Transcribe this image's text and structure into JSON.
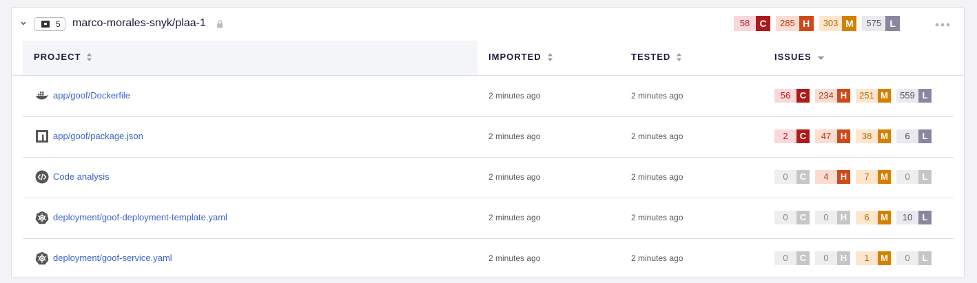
{
  "org": {
    "count": "5",
    "name": "marco-morales-snyk/plaa-1",
    "totals": [
      {
        "value": "58",
        "letter": "C",
        "level": "critical"
      },
      {
        "value": "285",
        "letter": "H",
        "level": "high"
      },
      {
        "value": "303",
        "letter": "M",
        "level": "medium"
      },
      {
        "value": "575",
        "letter": "L",
        "level": "low"
      }
    ]
  },
  "columns": {
    "project": "PROJECT",
    "imported": "IMPORTED",
    "tested": "TESTED",
    "issues": "ISSUES"
  },
  "rows": [
    {
      "icon": "docker-icon",
      "name": "app/goof/Dockerfile",
      "imported": "2 minutes ago",
      "tested": "2 minutes ago",
      "issues": {
        "c": "56",
        "h": "234",
        "m": "251",
        "l": "559"
      }
    },
    {
      "icon": "npm-icon",
      "name": "app/goof/package.json",
      "imported": "2 minutes ago",
      "tested": "2 minutes ago",
      "issues": {
        "c": "2",
        "h": "47",
        "m": "38",
        "l": "6"
      }
    },
    {
      "icon": "code-analysis-icon",
      "name": "Code analysis",
      "imported": "2 minutes ago",
      "tested": "2 minutes ago",
      "issues": {
        "c": "0",
        "h": "4",
        "m": "7",
        "l": "0"
      }
    },
    {
      "icon": "kubernetes-icon",
      "name": "deployment/goof-deployment-template.yaml",
      "imported": "2 minutes ago",
      "tested": "2 minutes ago",
      "issues": {
        "c": "0",
        "h": "0",
        "m": "6",
        "l": "10"
      }
    },
    {
      "icon": "kubernetes-icon",
      "name": "deployment/goof-service.yaml",
      "imported": "2 minutes ago",
      "tested": "2 minutes ago",
      "issues": {
        "c": "0",
        "h": "0",
        "m": "1",
        "l": "0"
      }
    }
  ],
  "severity_letters": {
    "c": "C",
    "h": "H",
    "m": "M",
    "l": "L"
  },
  "colors": {
    "critical": "#ad1a1a",
    "high": "#cf4a1b",
    "medium": "#d68000",
    "low": "#88879e",
    "link": "#3b63c9"
  }
}
